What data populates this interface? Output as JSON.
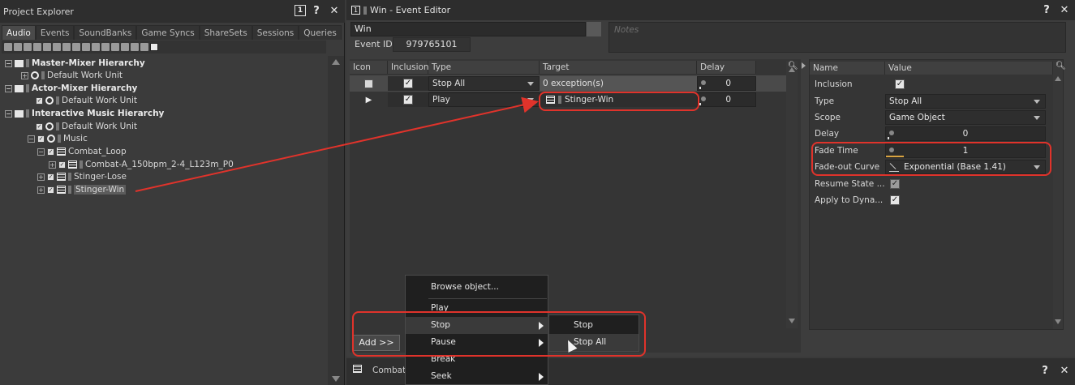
{
  "project_explorer": {
    "title": "Project Explorer",
    "tabs": [
      "Audio",
      "Events",
      "SoundBanks",
      "Game Syncs",
      "ShareSets",
      "Sessions",
      "Queries"
    ],
    "active_tab": "Audio",
    "tree": [
      {
        "label": "Master-Mixer Hierarchy",
        "bold": true
      },
      {
        "label": "Default Work Unit"
      },
      {
        "label": "Actor-Mixer Hierarchy",
        "bold": true
      },
      {
        "label": "Default Work Unit"
      },
      {
        "label": "Interactive Music Hierarchy",
        "bold": true
      },
      {
        "label": "Default Work Unit"
      },
      {
        "label": "Music"
      },
      {
        "label": "Combat_Loop"
      },
      {
        "label": "Combat-A_150bpm_2-4_L123m_P0"
      },
      {
        "label": "Stinger-Lose"
      },
      {
        "label": "Stinger-Win",
        "selected": true
      }
    ]
  },
  "event_editor": {
    "title": "Win - Event Editor",
    "name": "Win",
    "notes_placeholder": "Notes",
    "event_id_label": "Event ID",
    "event_id": "979765101",
    "columns": [
      "Icon",
      "Inclusion",
      "Type",
      "Target",
      "Delay"
    ],
    "actions": [
      {
        "type": "Stop All",
        "target": "0 exception(s)",
        "delay": "0"
      },
      {
        "type": "Play",
        "target": "Stinger-Win",
        "delay": "0"
      }
    ],
    "add_button": "Add >>",
    "properties": {
      "columns": [
        "Name",
        "Value"
      ],
      "rows": [
        {
          "name": "Inclusion",
          "value": ""
        },
        {
          "name": "Type",
          "value": "Stop All"
        },
        {
          "name": "Scope",
          "value": "Game Object"
        },
        {
          "name": "Delay",
          "value": "0"
        },
        {
          "name": "Fade Time",
          "value": "1"
        },
        {
          "name": "Fade-out Curve",
          "value": "Exponential (Base 1.41)"
        },
        {
          "name": "Resume State ...",
          "value": ""
        },
        {
          "name": "Apply to Dyna...",
          "value": ""
        }
      ]
    }
  },
  "bottom_panel": {
    "title": "Combat"
  },
  "context_menu": {
    "items": [
      "Browse object...",
      "Play",
      "Stop",
      "Pause",
      "Break",
      "Seek"
    ],
    "submenu": [
      "Stop",
      "Stop All"
    ]
  },
  "colors": {
    "annotation": "#e0332b",
    "accent": "#d9a441"
  }
}
